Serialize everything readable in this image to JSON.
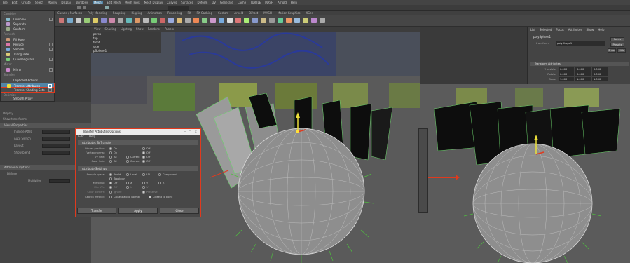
{
  "menubar": {
    "items": [
      "File",
      "Edit",
      "Create",
      "Select",
      "Modify",
      "Display",
      "Windows",
      "Mesh",
      "Edit Mesh",
      "Mesh Tools",
      "Mesh Display",
      "Curves",
      "Surfaces",
      "Deform",
      "UV",
      "Generate",
      "Cache",
      "TURTLE",
      "MASH",
      "Arnold",
      "Help"
    ]
  },
  "shelf_tabs": [
    "Curves / Surfaces",
    "Poly Modeling",
    "Sculpting",
    "Rigging",
    "Animation",
    "Rendering",
    "FX",
    "FX Caching",
    "Custom",
    "Arnold",
    "Bifrost",
    "MASH",
    "Motion Graphics",
    "XGen"
  ],
  "mesh_menu": {
    "sec_combine": "Combine",
    "combine": "Combine",
    "separate": "Separate",
    "conform": "Conform",
    "sec_remesh": "Remesh",
    "fill_hole": "Fill Hole",
    "reduce": "Reduce",
    "smooth": "Smooth",
    "triangulate": "Triangulate",
    "quadrangulate": "Quadrangulate",
    "sec_mirror": "Mirror",
    "mirror": "Mirror",
    "sec_transfer": "Transfer",
    "clipboard_actions": "Clipboard Actions",
    "transfer_attributes": "Transfer Attributes",
    "transfer_shading_sets": "Transfer Shading Sets",
    "sec_optimize": "Optimize",
    "cleanup": "Cleanup...",
    "smooth_proxy": "Smooth Proxy"
  },
  "left_panel": {
    "header1": "Visual Properties",
    "header2": "Additional Options",
    "row_display": "Display",
    "row_show_transform": "Show transforms",
    "row_include": "Include Attrs",
    "row_auto": "Auto Switch",
    "row_layout": "Layout",
    "row_show_blend": "Show blend",
    "sub1": "Diffuse",
    "sub2": "Multiplier"
  },
  "panel_menu": [
    "View",
    "Shading",
    "Lighting",
    "Show",
    "Renderer",
    "Panels"
  ],
  "dialog": {
    "title": "Transfer Attributes Options",
    "menu_edit": "Edit",
    "menu_help": "Help",
    "sect_transfer": "Attributes To Transfer",
    "lbl_vertex_position": "Vertex position:",
    "lbl_vertex_normal": "Vertex normal:",
    "lbl_uv_sets": "UV Sets:",
    "lbl_color_sets": "Color Sets:",
    "opt_on": "On",
    "opt_off": "Off",
    "opt_all": "All",
    "opt_current": "Current",
    "sect_settings": "Attribute Settings",
    "lbl_sample_space": "Sample space:",
    "opt_world": "World",
    "opt_local": "Local",
    "opt_uv": "UV",
    "opt_component": "Component",
    "opt_topology": "Topology",
    "lbl_mirroring": "Mirroring:",
    "opt_x": "X",
    "opt_y": "Y",
    "opt_z": "Z",
    "lbl_flip_uvs": "Flip UVs:",
    "opt_u": "U",
    "opt_v": "V",
    "lbl_color_borders": "Color borders:",
    "opt_ignore": "Ignore",
    "opt_preserve": "Preserve",
    "lbl_search_method": "Search method:",
    "opt_along_normal": "Closest along normal",
    "opt_to_point": "Closest to point",
    "btn_transfer": "Transfer",
    "btn_apply": "Apply",
    "btn_close": "Close"
  },
  "outliner_rows": [
    "persp",
    "top",
    "front",
    "side",
    "pSphere1"
  ],
  "right_panel": {
    "tabs": [
      "List",
      "Selected",
      "Focus",
      "Attributes",
      "Show",
      "Help"
    ],
    "node_tab": "polySphere1",
    "node_label": "transform:",
    "node_value": "polyShape1",
    "btn_focus": "Focus",
    "btn_presets": "Presets",
    "btn_show": "Show",
    "btn_hide": "Hide",
    "sect_transform": "Transform Attributes",
    "lbl_translate": "Translate",
    "lbl_rotate": "Rotate",
    "lbl_scale": "Scale",
    "v_zero": "0.000",
    "v_one": "1.000"
  },
  "colors": {
    "highlight": "#5285a6",
    "red": "#e03a1e",
    "sphere": "#8e8e8e",
    "wire_green": "#6bd36b",
    "card_dark": "#0d0d0d"
  }
}
